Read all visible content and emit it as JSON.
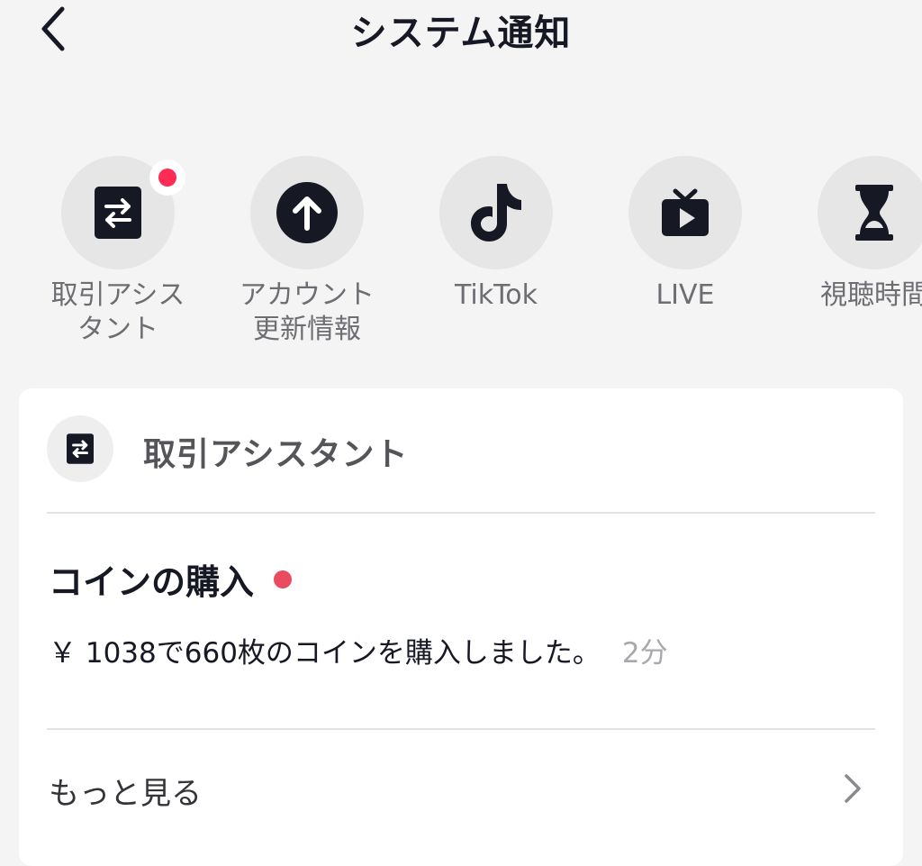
{
  "header": {
    "title": "システム通知",
    "back_icon": "chevron-left-icon"
  },
  "categories": [
    {
      "label": "取引アシス\nタント",
      "icon": "exchange-icon",
      "has_badge": true
    },
    {
      "label": "アカウント\n更新情報",
      "icon": "arrow-up-circle-icon",
      "has_badge": false
    },
    {
      "label": "TikTok",
      "icon": "tiktok-logo-icon",
      "has_badge": false
    },
    {
      "label": "LIVE",
      "icon": "live-tv-icon",
      "has_badge": false
    },
    {
      "label": "視聴時間",
      "icon": "hourglass-icon",
      "has_badge": false
    }
  ],
  "card": {
    "header_title": "取引アシスタント",
    "header_icon": "exchange-icon",
    "message": {
      "title": "コインの購入",
      "unread": true,
      "body": "￥ 1038で660枚のコインを購入しました。",
      "time": "2分"
    },
    "more_label": "もっと見る",
    "more_icon": "chevron-right-icon"
  },
  "colors": {
    "background": "#f4f4f4",
    "badge": "#fe2c55",
    "unread_dot": "#e94b5f",
    "text_primary": "#161823",
    "text_secondary": "#6d6d72"
  }
}
